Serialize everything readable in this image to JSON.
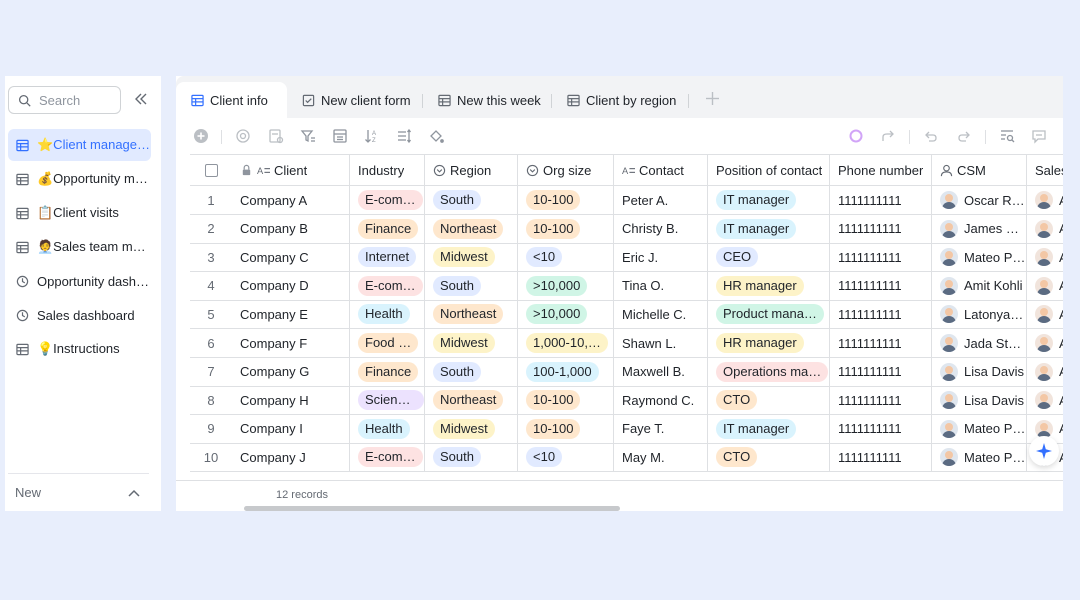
{
  "sidebar": {
    "search_placeholder": "Search",
    "items": [
      {
        "emoji": "⭐",
        "label": "Client manage…",
        "icon": "table-icon",
        "active": true
      },
      {
        "emoji": "💰",
        "label": "Opportunity m…",
        "icon": "table-icon"
      },
      {
        "emoji": "📋",
        "label": "Client visits",
        "icon": "table-icon"
      },
      {
        "emoji": "🧑‍💼",
        "label": "Sales team ma…",
        "icon": "table-icon"
      },
      {
        "emoji": "",
        "label": "Opportunity dashb…",
        "icon": "dashboard-icon"
      },
      {
        "emoji": "",
        "label": "Sales dashboard",
        "icon": "dashboard-icon"
      },
      {
        "emoji": "💡",
        "label": "Instructions",
        "icon": "table-icon"
      }
    ],
    "new_label": "New"
  },
  "tabs": [
    {
      "label": "Client info",
      "icon": "grid-view-icon",
      "active": true
    },
    {
      "label": "New client form",
      "icon": "form-view-icon"
    },
    {
      "label": "New this week",
      "icon": "grid-view-icon"
    },
    {
      "label": "Client by region",
      "icon": "grid-view-icon"
    }
  ],
  "columns": [
    "Client",
    "Industry",
    "Region",
    "Org size",
    "Contact",
    "Position of contact",
    "Phone number",
    "CSM",
    "Sales"
  ],
  "rows": [
    {
      "n": "1",
      "client": "Company A",
      "industry": "E-com…",
      "region": "South",
      "size": "10-100",
      "contact": "Peter A.",
      "position": "IT manager",
      "phone": "1111111111",
      "csm": "Oscar Ra…",
      "sales": "A"
    },
    {
      "n": "2",
      "client": "Company B",
      "industry": "Finance",
      "region": "Northeast",
      "size": "10-100",
      "contact": "Christy B.",
      "position": "IT manager",
      "phone": "1111111111",
      "csm": "James M…",
      "sales": "A"
    },
    {
      "n": "3",
      "client": "Company C",
      "industry": "Internet",
      "region": "Midwest",
      "size": "<10",
      "contact": "Eric J.",
      "position": "CEO",
      "phone": "1111111111",
      "csm": "Mateo Pe…",
      "sales": "A"
    },
    {
      "n": "4",
      "client": "Company D",
      "industry": "E-com…",
      "region": "South",
      "size": ">10,000",
      "contact": "Tina O.",
      "position": "HR manager",
      "phone": "1111111111",
      "csm": "Amit Kohli",
      "sales": "A"
    },
    {
      "n": "5",
      "client": "Company E",
      "industry": "Health",
      "region": "Northeast",
      "size": ">10,000",
      "contact": "Michelle C.",
      "position": "Product mana…",
      "phone": "1111111111",
      "csm": "Latonya …",
      "sales": "A"
    },
    {
      "n": "6",
      "client": "Company F",
      "industry": "Food …",
      "region": "Midwest",
      "size": "1,000-10,…",
      "contact": "Shawn L.",
      "position": "HR manager",
      "phone": "1111111111",
      "csm": "Jada Stal…",
      "sales": "A"
    },
    {
      "n": "7",
      "client": "Company G",
      "industry": "Finance",
      "region": "South",
      "size": "100-1,000",
      "contact": "Maxwell B.",
      "position": "Operations ma…",
      "phone": "1111111111",
      "csm": "Lisa Davis",
      "sales": "A"
    },
    {
      "n": "8",
      "client": "Company H",
      "industry": "Scienc…",
      "region": "Northeast",
      "size": "10-100",
      "contact": "Raymond C.",
      "position": "CTO",
      "phone": "1111111111",
      "csm": "Lisa Davis",
      "sales": "A"
    },
    {
      "n": "9",
      "client": "Company I",
      "industry": "Health",
      "region": "Midwest",
      "size": "10-100",
      "contact": "Faye T.",
      "position": "IT manager",
      "phone": "1111111111",
      "csm": "Mateo Pe…",
      "sales": "A"
    },
    {
      "n": "10",
      "client": "Company J",
      "industry": "E-com…",
      "region": "South",
      "size": "<10",
      "contact": "May M.",
      "position": "CTO",
      "phone": "1111111111",
      "csm": "Mateo Pe…",
      "sales": "A"
    }
  ],
  "tag_colors": {
    "E-com…": "#fde2e2",
    "Finance": "#fee7cd",
    "Internet": "#e1eaff",
    "Health": "#d9f3fd",
    "Food …": "#fee7cd",
    "Scienc…": "#ece2fe",
    "South": "#e1eaff",
    "Northeast": "#fee7cd",
    "Midwest": "#fdf3c8",
    "10-100": "#fee7cd",
    "<10": "#e1eaff",
    ">10,000": "#d0f5e6",
    "1,000-10,…": "#fdf3c8",
    "100-1,000": "#d9f3fd",
    "IT manager": "#d9f3fd",
    "CEO": "#e1eaff",
    "HR manager": "#fdf3c8",
    "Product mana…": "#d0f5e6",
    "Operations ma…": "#fde2e2",
    "CTO": "#fee7cd"
  },
  "avatar_colors": [
    "#6b4f3a",
    "#4a6a8a",
    "#3b3b3b",
    "#7a6b5a",
    "#2f2f2f",
    "#5a4636",
    "#8a5a4a",
    "#8a5a4a",
    "#3b3b3b",
    "#3b3b3b"
  ],
  "footer": {
    "records": "12 records"
  }
}
